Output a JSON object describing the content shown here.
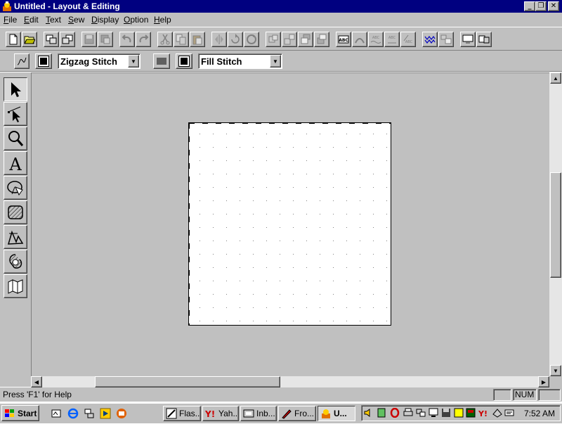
{
  "window": {
    "title": "Untitled - Layout & Editing",
    "app_icon": "embroidery-app-icon",
    "caption_buttons": [
      "minimize",
      "restore",
      "close"
    ]
  },
  "menu": [
    {
      "label": "File",
      "accel": "F"
    },
    {
      "label": "Edit",
      "accel": "E"
    },
    {
      "label": "Text",
      "accel": "T"
    },
    {
      "label": "Sew",
      "accel": "S"
    },
    {
      "label": "Display",
      "accel": "D"
    },
    {
      "label": "Option",
      "accel": "O"
    },
    {
      "label": "Help",
      "accel": "H"
    }
  ],
  "toolbar": {
    "icons": [
      "new-file-icon",
      "open-folder-icon",
      "import-icon",
      "export-icon",
      "save-icon",
      "save-as-icon",
      "undo-icon",
      "redo-icon",
      "cut-icon",
      "copy-icon",
      "paste-icon",
      "mirror-icon",
      "rotate-icon",
      "rotate-free-icon",
      "group-icon",
      "ungroup-icon",
      "front-icon",
      "back-icon",
      "text-abc-icon",
      "text-arc-icon",
      "text-wave-icon",
      "text-vertical-icon",
      "text-slant-icon",
      "stitch-wave-icon",
      "stitch-block-icon",
      "monitor-icon",
      "transfer-icon"
    ]
  },
  "stitchbar": {
    "line_sew_icon": "line-sew-icon",
    "line_color_icon": "line-color-icon",
    "line_stitch": "Zigzag Stitch",
    "fill_sew_icon": "fill-sew-icon",
    "fill_color_icon": "fill-color-icon",
    "fill_stitch": "Fill Stitch"
  },
  "tools": [
    "select-arrow-icon",
    "point-edit-icon",
    "zoom-icon",
    "text-icon",
    "circle-arc-icon",
    "rectangle-icon",
    "outline-icon",
    "stamp-icon",
    "manual-punch-icon"
  ],
  "status": {
    "help_text": "Press 'F1' for Help",
    "indicator": "NUM"
  },
  "taskbar": {
    "start_label": "Start",
    "quicklaunch": [
      "show-desktop-icon",
      "internet-explorer-icon",
      "network-icon",
      "media-player-icon",
      "outlook-express-icon"
    ],
    "tasks": [
      {
        "label": "Flas...",
        "icon": "flash-icon"
      },
      {
        "label": "Yah...",
        "icon": "yahoo-icon"
      },
      {
        "label": "Inb...",
        "icon": "inbox-icon"
      },
      {
        "label": "Fro...",
        "icon": "frontpage-icon"
      },
      {
        "label": "U...",
        "icon": "embroidery-app-icon"
      }
    ],
    "tray_icons": [
      "volume-icon",
      "tray-app-icon",
      "opera-icon",
      "printer-icon",
      "network-tray-icon",
      "tray-monitor-icon",
      "tray-floppy-icon",
      "tray-yellow-icon",
      "tray-green-icon",
      "yahoo-messenger-icon",
      "tray-disk-icon",
      "tray-misc-icon"
    ],
    "clock": "7:52 AM"
  },
  "colors": {
    "title_bar": "#000080",
    "face": "#c0c0c0",
    "canvas": "#ffffff",
    "yahoo_red": "#cc0000"
  }
}
